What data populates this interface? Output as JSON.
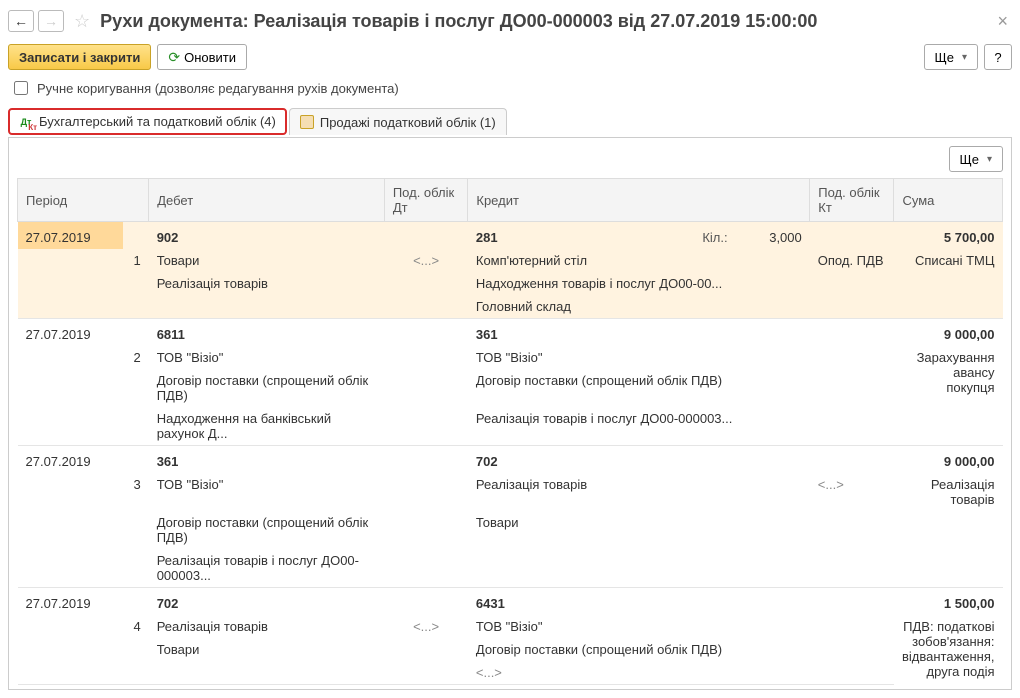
{
  "title": "Рухи документа: Реалізація товарів і послуг ДО00-000003 від 27.07.2019 15:00:00",
  "toolbar": {
    "save_close": "Записати і закрити",
    "refresh": "Оновити",
    "more": "Ще",
    "help": "?"
  },
  "manual_edit": {
    "label": "Ручне коригування (дозволяє редагування рухів документа)",
    "checked": false
  },
  "tabs": [
    {
      "label": "Бухгалтерський та податковий облік (4)",
      "active": true
    },
    {
      "label": "Продажі податковий облік (1)",
      "active": false
    }
  ],
  "grid": {
    "more": "Ще",
    "headers": {
      "period": "Період",
      "debit": "Дебет",
      "pod_dt": "Под. облік Дт",
      "credit": "Кредит",
      "pod_kt": "Под. облік Кт",
      "sum": "Сума",
      "kil": "Кіл.:"
    },
    "rows": [
      {
        "selected": true,
        "period": "27.07.2019",
        "num": "1",
        "debit_acc": "902",
        "debit_lines": [
          "Товари",
          "Реалізація товарів"
        ],
        "pod_dt": "<...>",
        "credit_acc": "281",
        "qty": "3,000",
        "credit_lines": [
          "Комп'ютерний стіл",
          "Надходження товарів і послуг ДО00-00...",
          "Головний склад"
        ],
        "pod_kt": "Опод. ПДВ",
        "sum": "5 700,00",
        "sum_note": "Списані ТМЦ"
      },
      {
        "period": "27.07.2019",
        "num": "2",
        "debit_acc": "6811",
        "debit_lines": [
          "ТОВ \"Візіо\"",
          "Договір поставки (спрощений облік ПДВ)",
          "Надходження на банківський рахунок Д..."
        ],
        "credit_acc": "361",
        "credit_lines": [
          "ТОВ \"Візіо\"",
          "Договір поставки (спрощений облік ПДВ)",
          "Реалізація товарів і послуг ДО00-000003..."
        ],
        "sum": "9 000,00",
        "sum_note": "Зарахування авансу покупця"
      },
      {
        "period": "27.07.2019",
        "num": "3",
        "debit_acc": "361",
        "debit_lines": [
          "ТОВ \"Візіо\"",
          "Договір поставки (спрощений облік ПДВ)",
          "Реалізація товарів і послуг ДО00-000003..."
        ],
        "credit_acc": "702",
        "credit_lines": [
          "Реалізація товарів",
          "Товари"
        ],
        "pod_kt": "<...>",
        "sum": "9 000,00",
        "sum_note": "Реалізація товарів"
      },
      {
        "period": "27.07.2019",
        "num": "4",
        "debit_acc": "702",
        "debit_lines": [
          "Реалізація товарів",
          "Товари"
        ],
        "pod_dt": "<...>",
        "credit_acc": "6431",
        "credit_lines": [
          "ТОВ \"Візіо\"",
          "Договір поставки (спрощений облік ПДВ)",
          "<...>"
        ],
        "sum": "1 500,00",
        "sum_note": "ПДВ: податкові зобов'язання: відвантаження, друга подія"
      }
    ]
  }
}
